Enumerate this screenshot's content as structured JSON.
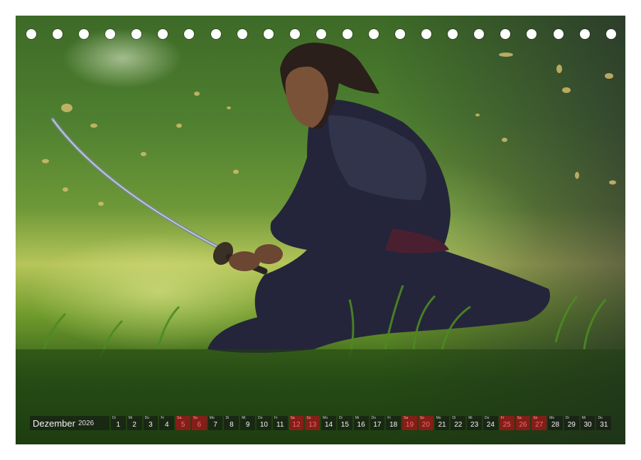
{
  "calendar": {
    "month": "Dezember",
    "year": "2026",
    "days": [
      {
        "wd": "Di",
        "num": "1",
        "weekend": false
      },
      {
        "wd": "Mi",
        "num": "2",
        "weekend": false
      },
      {
        "wd": "Do",
        "num": "3",
        "weekend": false
      },
      {
        "wd": "Fr",
        "num": "4",
        "weekend": false
      },
      {
        "wd": "Sa",
        "num": "5",
        "weekend": true
      },
      {
        "wd": "So",
        "num": "6",
        "weekend": true
      },
      {
        "wd": "Mo",
        "num": "7",
        "weekend": false
      },
      {
        "wd": "Di",
        "num": "8",
        "weekend": false
      },
      {
        "wd": "Mi",
        "num": "9",
        "weekend": false
      },
      {
        "wd": "Do",
        "num": "10",
        "weekend": false
      },
      {
        "wd": "Fr",
        "num": "11",
        "weekend": false
      },
      {
        "wd": "Sa",
        "num": "12",
        "weekend": true
      },
      {
        "wd": "So",
        "num": "13",
        "weekend": true
      },
      {
        "wd": "Mo",
        "num": "14",
        "weekend": false
      },
      {
        "wd": "Di",
        "num": "15",
        "weekend": false
      },
      {
        "wd": "Mi",
        "num": "16",
        "weekend": false
      },
      {
        "wd": "Do",
        "num": "17",
        "weekend": false
      },
      {
        "wd": "Fr",
        "num": "18",
        "weekend": false
      },
      {
        "wd": "Sa",
        "num": "19",
        "weekend": true
      },
      {
        "wd": "So",
        "num": "20",
        "weekend": true
      },
      {
        "wd": "Mo",
        "num": "21",
        "weekend": false
      },
      {
        "wd": "Di",
        "num": "22",
        "weekend": false
      },
      {
        "wd": "Mi",
        "num": "23",
        "weekend": false
      },
      {
        "wd": "Do",
        "num": "24",
        "weekend": false
      },
      {
        "wd": "Fr",
        "num": "25",
        "weekend": true
      },
      {
        "wd": "Sa",
        "num": "26",
        "weekend": true
      },
      {
        "wd": "So",
        "num": "27",
        "weekend": true
      },
      {
        "wd": "Mo",
        "num": "28",
        "weekend": false
      },
      {
        "wd": "Di",
        "num": "29",
        "weekend": false
      },
      {
        "wd": "Mi",
        "num": "30",
        "weekend": false
      },
      {
        "wd": "Do",
        "num": "31",
        "weekend": false
      }
    ]
  },
  "binding": {
    "hole_count": 23
  },
  "photo": {
    "subject": "samurai-icon"
  },
  "colors": {
    "weekend": "#961919",
    "bar": "#141414",
    "grass": "#4f8030"
  }
}
